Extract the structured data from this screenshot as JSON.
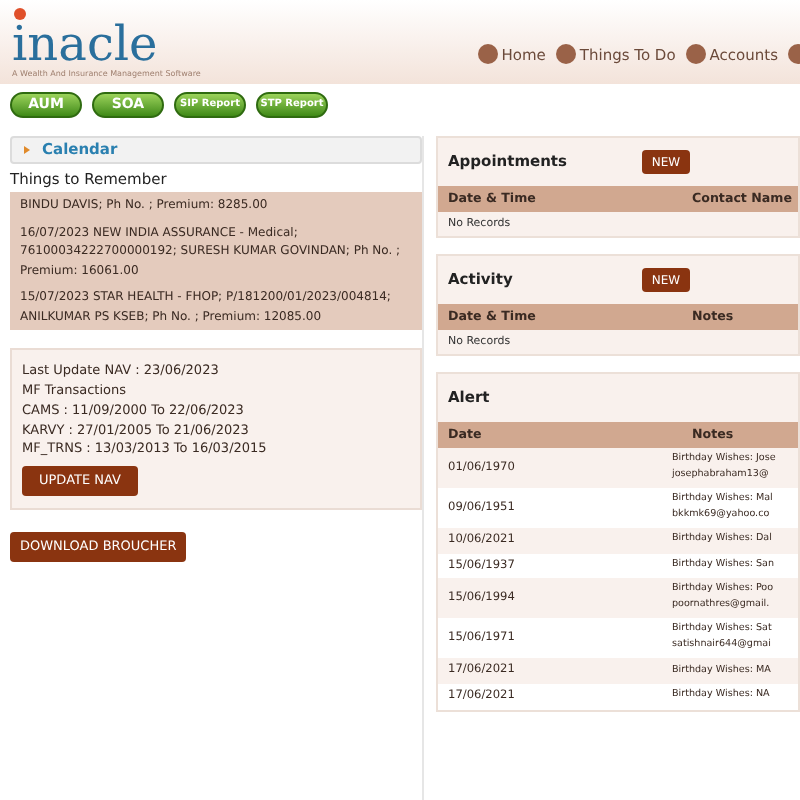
{
  "header": {
    "logo": "inacle",
    "tagline": "A Wealth And Insurance Management Software",
    "nav": [
      {
        "label": "Home"
      },
      {
        "label": "Things To Do"
      },
      {
        "label": "Accounts"
      }
    ]
  },
  "report_buttons": [
    {
      "label": "AUM",
      "kind": "large"
    },
    {
      "label": "SOA",
      "kind": "large"
    },
    {
      "label": "SIP Report",
      "kind": "small"
    },
    {
      "label": "STP Report",
      "kind": "small"
    }
  ],
  "calendar": {
    "title": "Calendar",
    "heading": "Things to Remember",
    "items": [
      "BINDU DAVIS; Ph No. ; Premium: 8285.00",
      "16/07/2023 NEW INDIA ASSURANCE - Medical; 76100034222700000192; SURESH KUMAR GOVINDAN; Ph No. ; Premium: 16061.00",
      "15/07/2023 STAR HEALTH - FHOP; P/181200/01/2023/004814; ANILKUMAR PS KSEB; Ph No. ; Premium: 12085.00"
    ]
  },
  "nav_info": {
    "lines": [
      "Last Update NAV : 23/06/2023",
      "MF Transactions",
      "CAMS : 11/09/2000 To 22/06/2023",
      "KARVY : 27/01/2005 To 21/06/2023",
      "MF_TRNS : 13/03/2013 To 16/03/2015"
    ],
    "button": "UPDATE NAV"
  },
  "download_button": "DOWNLOAD BROUCHER",
  "appointments": {
    "title": "Appointments",
    "button": "NEW",
    "columns": [
      "Date & Time",
      "Contact Name"
    ],
    "empty": "No Records"
  },
  "activity": {
    "title": "Activity",
    "button": "NEW",
    "columns": [
      "Date & Time",
      "Notes"
    ],
    "empty": "No Records"
  },
  "alert": {
    "title": "Alert",
    "columns": [
      "Date",
      "Notes"
    ],
    "rows": [
      {
        "date": "01/06/1970",
        "notes": [
          "Birthday Wishes: Jose",
          "josephabraham13@"
        ]
      },
      {
        "date": "09/06/1951",
        "notes": [
          "Birthday Wishes: Mal",
          "bkkmk69@yahoo.co"
        ]
      },
      {
        "date": "10/06/2021",
        "notes": [
          "Birthday Wishes: Dal"
        ]
      },
      {
        "date": "15/06/1937",
        "notes": [
          "Birthday Wishes: San"
        ]
      },
      {
        "date": "15/06/1994",
        "notes": [
          "Birthday Wishes: Poo",
          "poornathres@gmail."
        ]
      },
      {
        "date": "15/06/1971",
        "notes": [
          "Birthday Wishes: Sat",
          "satishnair644@gmai"
        ]
      },
      {
        "date": "17/06/2021",
        "notes": [
          "Birthday Wishes: MA"
        ]
      },
      {
        "date": "17/06/2021",
        "notes": [
          "Birthday Wishes: NA"
        ]
      }
    ]
  }
}
